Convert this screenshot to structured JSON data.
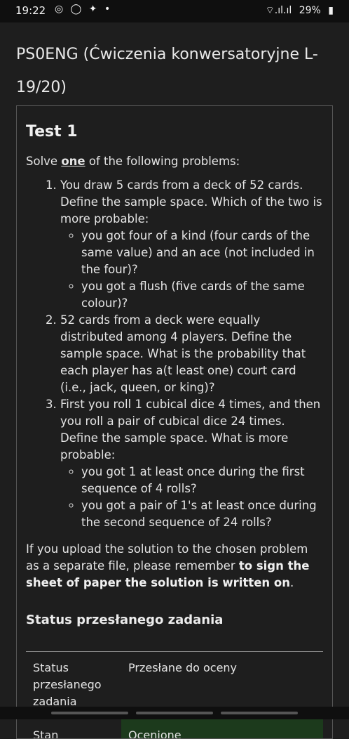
{
  "status_bar": {
    "time": "19:22",
    "icons": "◎ ◯ ✦ •",
    "signal": "⌔.ıl.ıl",
    "battery": "29%",
    "battery_icon": "▮"
  },
  "course": {
    "title": "PS0ENG (Ćwiczenia konwersatoryjne L-19/20)"
  },
  "assignment": {
    "title": "Test 1",
    "intro_before": "Solve ",
    "intro_emph": "one",
    "intro_after": " of the following problems:",
    "problems": [
      {
        "text": "You draw 5 cards from a deck of 52 cards. Define the sample space. Which of the two is more probable:",
        "sub": [
          "you got four of a kind (four cards of the same value) and an ace (not included in the four)?",
          "you got a flush (five cards of the same colour)?"
        ]
      },
      {
        "text": "52 cards from a deck were equally distributed among 4 players. Define the sample space. What is the probability that each player has a(t least one) court card (i.e., jack, queen, or king)?"
      },
      {
        "text": "First you roll 1 cubical dice 4 times, and then you roll a pair of cubical dice 24 times. Define the sample space. What is more probable:",
        "sub": [
          "you got 1 at least once during the first sequence of 4 rolls?",
          "you got a pair of 1's at least once during the second sequence of 24 rolls?"
        ]
      }
    ],
    "note_before": "If you upload the solution to the chosen problem as a separate file, please remember ",
    "note_bold": "to sign the sheet of paper the solution is written on",
    "note_after": "."
  },
  "submission_status": {
    "heading": "Status przesłanego zadania",
    "rows": [
      {
        "label": "Status przesłanego zadania",
        "value": "Przesłane do oceny"
      },
      {
        "label": "Stan oceniania",
        "value": "Ocenione"
      }
    ]
  }
}
